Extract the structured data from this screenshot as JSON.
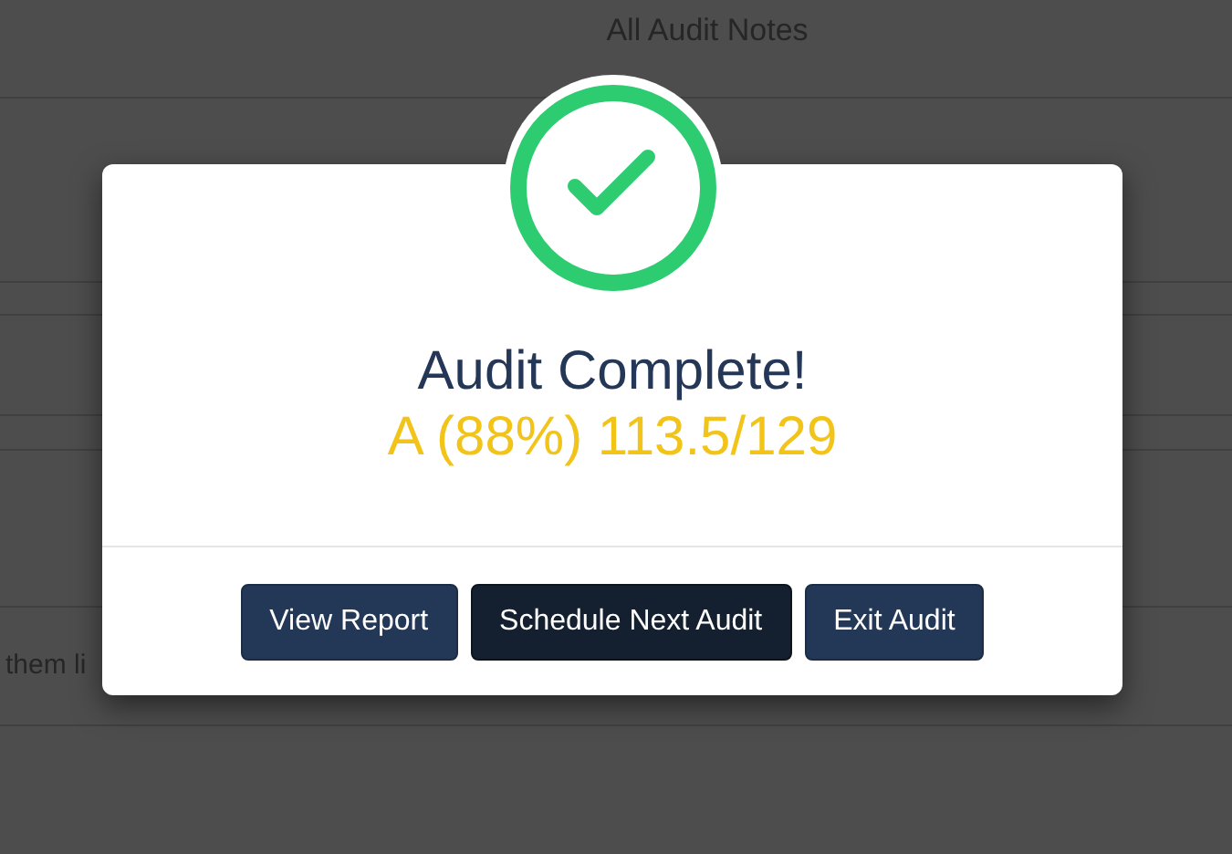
{
  "page": {
    "title": "All Audit Notes",
    "fragment": "them li"
  },
  "dialog": {
    "title": "Audit Complete!",
    "score": "A (88%) 113.5/129",
    "buttons": [
      {
        "label": "View Report",
        "focused": false
      },
      {
        "label": "Schedule Next Audit",
        "focused": true
      },
      {
        "label": "Exit Audit",
        "focused": false
      }
    ]
  }
}
